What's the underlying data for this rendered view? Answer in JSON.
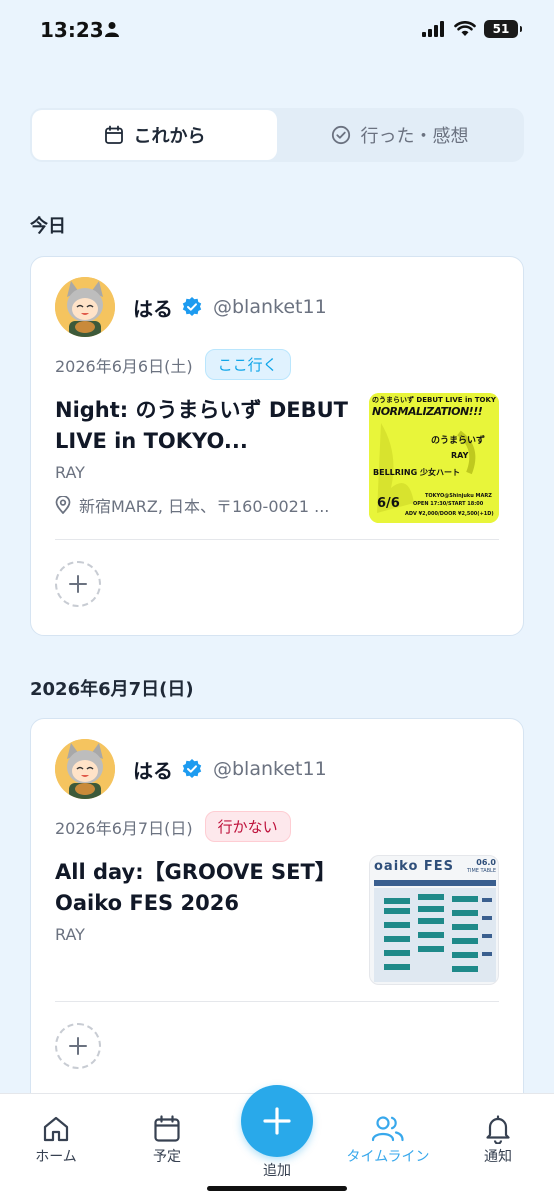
{
  "status": {
    "time": "13:23",
    "battery": "51"
  },
  "tabs": {
    "upcoming": "これから",
    "past": "行った・感想"
  },
  "sections": [
    {
      "title": "今日",
      "card": {
        "user_name": "はる",
        "user_handle": "@blanket11",
        "date": "2026年6月6日(土)",
        "badge": "ここ行く",
        "title": "Night: のうまらいず DEBUT LIVE in TOKYO...",
        "artist": "RAY",
        "venue": "新宿MARZ, 日本、〒160-0021 ...",
        "flyer": {
          "top_line": "のうまらいず DEBUT LIVE in TOKYO",
          "headline": "NORMALIZATION!!!",
          "act1": "のうまらいず",
          "act2": "RAY",
          "act3": "BELLRING 少女ハート",
          "date": "6/6",
          "venue_line": "TOKYO@Shinjuku MARZ",
          "time_line": "OPEN 17:30/START 18:00",
          "price_line": "ADV ¥2,000/DOOR ¥2,500(+1D)"
        }
      }
    },
    {
      "title": "2026年6月7日(日)",
      "card": {
        "user_name": "はる",
        "user_handle": "@blanket11",
        "date": "2026年6月7日(日)",
        "badge": "行かない",
        "title": "All day:【GROOVE SET】Oaiko FES 2026",
        "artist": "RAY",
        "flyer": {
          "logo": "oaiko FES",
          "date": "06.0",
          "subtitle": "TIME TABLE"
        }
      }
    }
  ],
  "nav": {
    "home": "ホーム",
    "schedule": "予定",
    "add": "追加",
    "timeline": "タイムライン",
    "notifications": "通知"
  },
  "colors": {
    "background": "#eaf4fd",
    "accent": "#29a9ea",
    "badge_go": "#0ea5e9",
    "badge_no": "#be123c",
    "flyer_yellow": "#e8f53a"
  }
}
